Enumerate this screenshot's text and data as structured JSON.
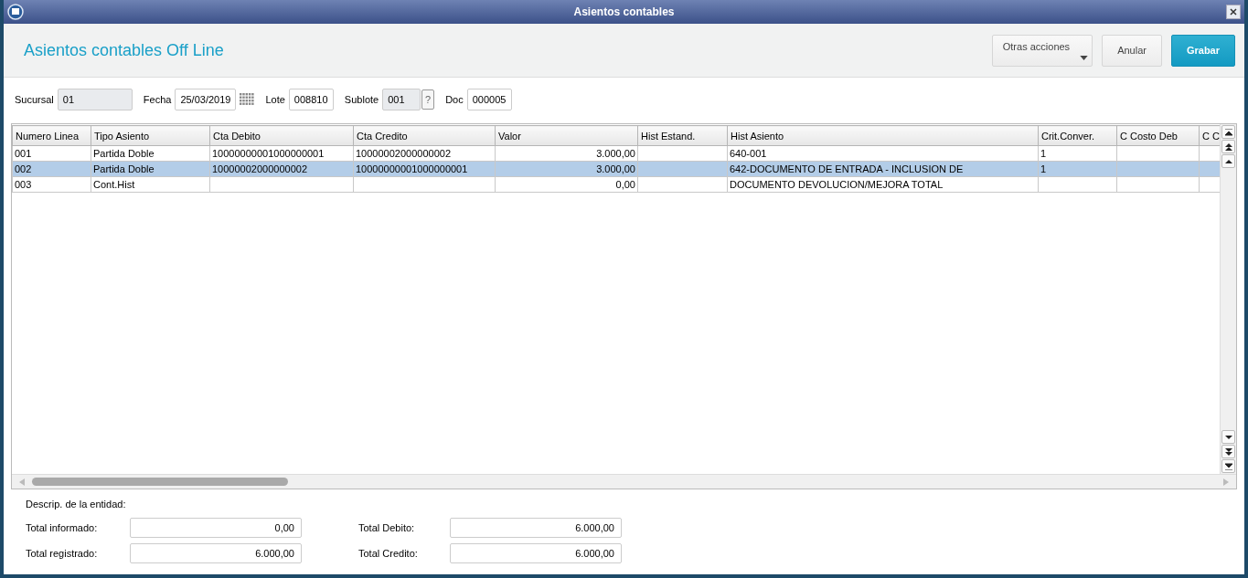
{
  "window": {
    "title": "Asientos contables"
  },
  "header": {
    "title": "Asientos contables Off Line",
    "buttons": [
      {
        "label": "Otras acciones",
        "kind": "menu"
      },
      {
        "label": "Anular",
        "kind": "plain"
      },
      {
        "label": "Grabar",
        "kind": "primary"
      }
    ]
  },
  "filters": [
    {
      "label": "Sucursal",
      "value": "01",
      "disabled": true,
      "kind": "plain"
    },
    {
      "label": "Fecha",
      "value": "25/03/2019",
      "disabled": false,
      "kind": "date"
    },
    {
      "label": "Lote",
      "value": "008810",
      "disabled": false,
      "kind": "plain"
    },
    {
      "label": "Sublote",
      "value": "001",
      "disabled": true,
      "kind": "lookup",
      "lookup_text": "?"
    },
    {
      "label": "Doc",
      "value": "000005",
      "disabled": false,
      "kind": "plain"
    }
  ],
  "table": {
    "columns": [
      "Numero Linea",
      "Tipo Asiento",
      "Cta Debito",
      "Cta Credito",
      "Valor",
      "Hist Estand.",
      "Hist Asiento",
      "Crit.Conver.",
      "C Costo Deb",
      "C C"
    ],
    "rows": [
      {
        "selected": false,
        "cells": [
          "001",
          "Partida Doble",
          "10000000001000000001",
          "10000002000000002",
          "3.000,00",
          "",
          "640-001",
          "1",
          "",
          ""
        ]
      },
      {
        "selected": true,
        "cells": [
          "002",
          "Partida Doble",
          "10000002000000002",
          "10000000001000000001",
          "3.000,00",
          "",
          "642-DOCUMENTO DE ENTRADA - INCLUSION DE",
          "1",
          "",
          ""
        ]
      },
      {
        "selected": false,
        "cells": [
          "003",
          "Cont.Hist",
          "",
          "",
          "0,00",
          "",
          "DOCUMENTO DEVOLUCION/MEJORA TOTAL",
          "",
          "",
          ""
        ]
      }
    ]
  },
  "footer": {
    "description_label": "Descrip. de la entidad:",
    "totals": [
      {
        "label": "Total informado:",
        "value": "0,00"
      },
      {
        "label": "Total Debito:",
        "value": "6.000,00"
      },
      {
        "label": "Total registrado:",
        "value": "6.000,00"
      },
      {
        "label": "Total Credito:",
        "value": "6.000,00"
      }
    ]
  }
}
